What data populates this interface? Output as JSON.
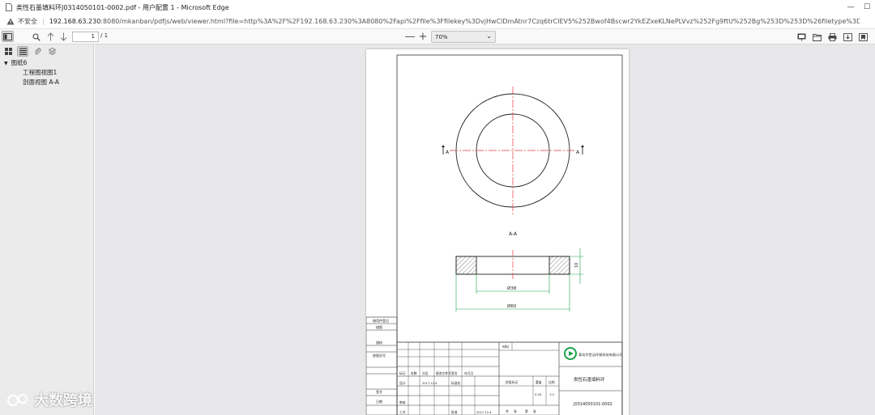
{
  "window": {
    "title": "类性石墨填料环J0314050101-0002.pdf - 用户配置 1 - Microsoft Edge",
    "controls": [
      "—",
      "☐"
    ]
  },
  "address": {
    "security_label": "不安全",
    "host": "192.168.63.230",
    "path": ":8080/mkanban/pdfjs/web/viewer.html?file=http%3A%2F%2F192.168.63.230%3A8080%2Fapi%2Ffile%3Ffilekey%3DvjHwClDmAtnr7Czq6trClEV5%252Bwof4Bscwr2YkEZxeKLNePLVvz%252Fg9ftU%252Bg%253D%253D%26filetype%3Dpdf%26token%3DZXlKaGJHY2l..."
  },
  "toolbar": {
    "page_current": "1",
    "page_total": "/ 1",
    "zoom_out": "—",
    "zoom_in": "+",
    "zoom_value": "70%"
  },
  "sidebar": {
    "outline": [
      {
        "label": "图纸6",
        "level": 0
      },
      {
        "label": "工程图视图1",
        "level": 1
      },
      {
        "label": "剖面视图 A-A",
        "level": 1
      }
    ]
  },
  "drawing": {
    "label_a_left": "A",
    "label_a_right": "A",
    "section_title": "A-A",
    "dim_height": "10",
    "dim_inner": "Ø38",
    "dim_outer": "Ø60",
    "tb_material_label": "材料",
    "tb_name": "类性石墨填料环",
    "tb_drawing_no": "J0314050101-0002",
    "tb_company": "青岛华世洁环保科技有限公司",
    "tb_scale_value": "1:1",
    "tb_weight_value": "0.04",
    "tb_date": "2017-12-4",
    "left_labels": [
      "借用件登记",
      "描图",
      "描校",
      "底图总号",
      "签字",
      "日期"
    ],
    "tb_cells": [
      "标记",
      "处数",
      "分区",
      "更改文件号",
      "签名",
      "年月日",
      "设计",
      "审核",
      "工艺",
      "标准化",
      "批准",
      "阶段标记",
      "重量",
      "比例",
      "共",
      "张",
      "第",
      "张"
    ]
  },
  "watermark": {
    "text": "大数跨境"
  }
}
